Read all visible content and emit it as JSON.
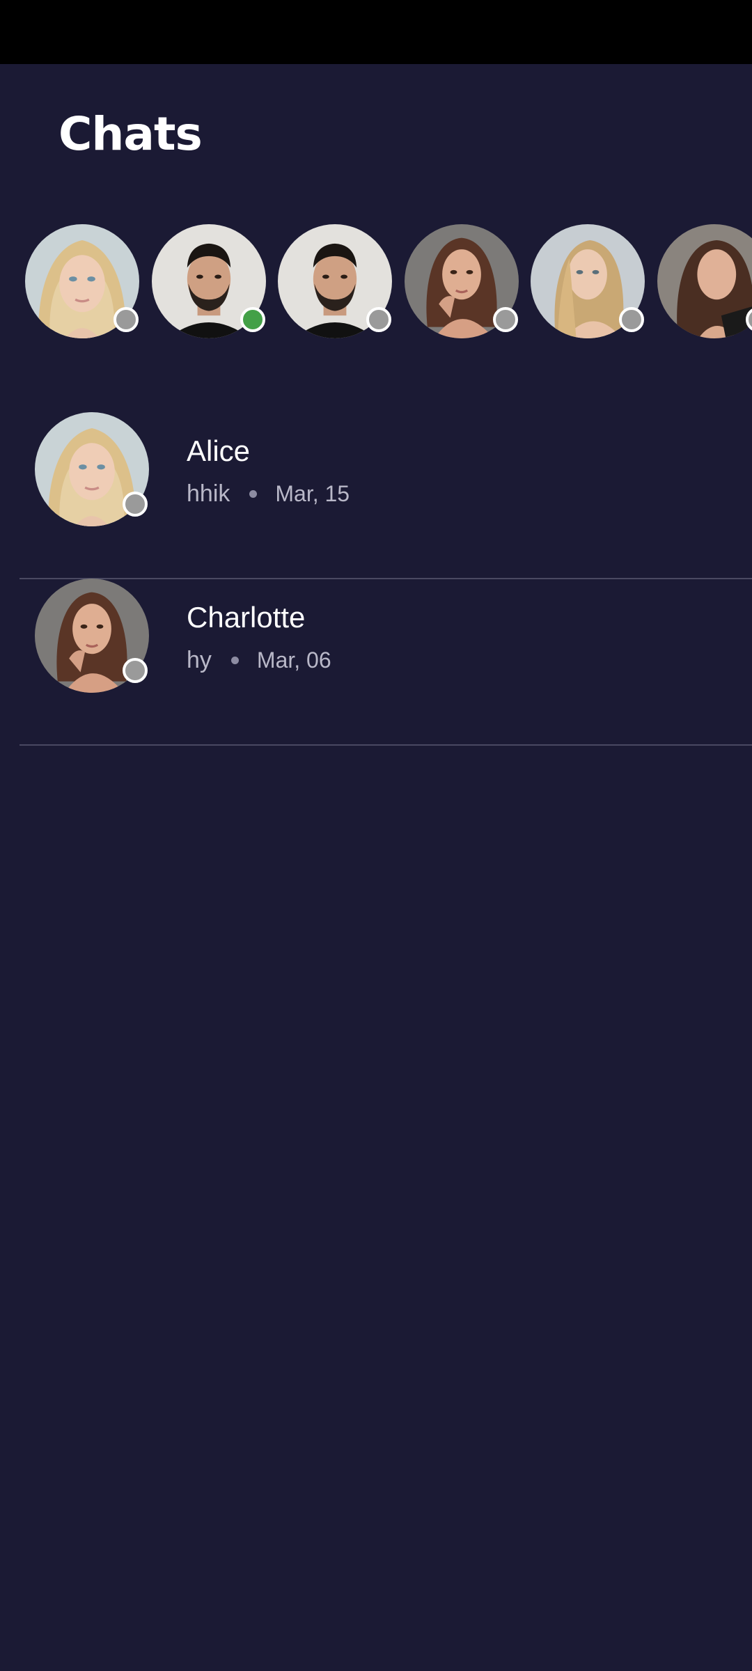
{
  "header": {
    "title": "Chats"
  },
  "colors": {
    "background": "#1b1a34",
    "status_bar": "#000000",
    "online": "#43a047",
    "offline": "#9a9a9a",
    "divider": "#4a4962"
  },
  "stories": [
    {
      "name": "story-1",
      "avatar": "blonde-woman",
      "status": "offline"
    },
    {
      "name": "story-2",
      "avatar": "bearded-man",
      "status": "online"
    },
    {
      "name": "story-3",
      "avatar": "bearded-man",
      "status": "offline"
    },
    {
      "name": "story-4",
      "avatar": "brunette-woman",
      "status": "offline"
    },
    {
      "name": "story-5",
      "avatar": "blonde-woman-2",
      "status": "offline"
    },
    {
      "name": "story-6",
      "avatar": "brunette-woman-2",
      "status": "offline"
    }
  ],
  "chats": [
    {
      "name": "Alice",
      "last_message": "hhik",
      "date": "Mar, 15",
      "avatar": "blonde-woman",
      "status": "offline"
    },
    {
      "name": "Charlotte",
      "last_message": "hy",
      "date": "Mar, 06",
      "avatar": "brunette-woman",
      "status": "offline"
    }
  ]
}
